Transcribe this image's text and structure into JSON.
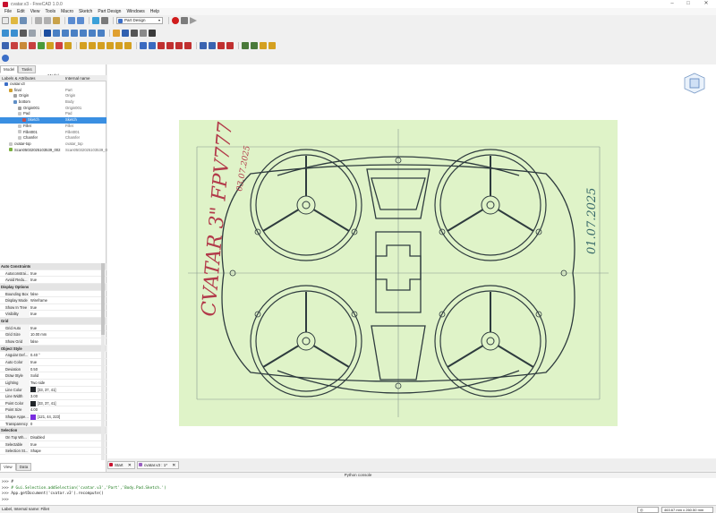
{
  "window": {
    "title": "cvatar.v3 - FreeCAD 1.0.0",
    "controls": [
      "–",
      "□",
      "✕"
    ]
  },
  "menu": [
    "File",
    "Edit",
    "View",
    "Tools",
    "Macro",
    "Sketch",
    "Part Design",
    "Windows",
    "Help"
  ],
  "toolbar": {
    "workbench": "Part Design"
  },
  "left_panel": {
    "tabs": [
      "Model",
      "Tasks"
    ],
    "header_title": "Model",
    "columns": [
      "Labels & Attributes",
      "Internal name"
    ],
    "tree": [
      {
        "label": "cvatar.v3",
        "internal": "",
        "indent": 1,
        "icon": "document-icon",
        "color": "#3b6ec7"
      },
      {
        "label": "final",
        "internal": "Part",
        "indent": 2,
        "icon": "part-icon",
        "color": "#d0a030"
      },
      {
        "label": "Origin",
        "internal": "Origin",
        "indent": 3,
        "icon": "origin-icon",
        "color": "#a0a0a0"
      },
      {
        "label": "bottom",
        "internal": "Body",
        "indent": 3,
        "icon": "body-icon",
        "color": "#5f8fc7"
      },
      {
        "label": "Origin001",
        "internal": "Origin001",
        "indent": 4,
        "icon": "origin-icon",
        "color": "#a0a0a0"
      },
      {
        "label": "Pad",
        "internal": "Pad",
        "indent": 4,
        "icon": "pad-icon",
        "color": "#c7c7c7"
      },
      {
        "label": "Sketch",
        "internal": "Sketch",
        "indent": 5,
        "icon": "sketch-icon",
        "color": "#c45050",
        "selected": true
      },
      {
        "label": "Fillet",
        "internal": "Fillet",
        "indent": 4,
        "icon": "fillet-icon",
        "color": "#c7c7c7"
      },
      {
        "label": "Fillet001",
        "internal": "Fillet001",
        "indent": 4,
        "icon": "fillet-icon",
        "color": "#c7c7c7"
      },
      {
        "label": "Chamfer",
        "internal": "Chamfer",
        "indent": 4,
        "icon": "chamfer-icon",
        "color": "#c7c7c7"
      },
      {
        "label": "cvatar-top",
        "internal": "cvatar_top",
        "indent": 2,
        "icon": "body-icon",
        "color": "#c7c7c7"
      },
      {
        "label": "Scan05032025103539_002",
        "internal": "Scan05032025103539_002",
        "indent": 2,
        "icon": "image-icon",
        "color": "#7ab040"
      }
    ],
    "properties": [
      {
        "group": "Auto Constraints"
      },
      {
        "name": "Autoconstrai...",
        "value": "true"
      },
      {
        "name": "Avoid Redu...",
        "value": "true"
      },
      {
        "group": "Display Options"
      },
      {
        "name": "Bounding Box",
        "value": "false"
      },
      {
        "name": "Display Mode",
        "value": "Wireframe"
      },
      {
        "name": "Show In Tree",
        "value": "true"
      },
      {
        "name": "Visibility",
        "value": "true"
      },
      {
        "group": "Grid"
      },
      {
        "name": "Grid Auto",
        "value": "true"
      },
      {
        "name": "Grid Size",
        "value": "10.00 mm"
      },
      {
        "name": "Show Grid",
        "value": "false"
      },
      {
        "group": "Object Style"
      },
      {
        "name": "Angular Def...",
        "value": "0.40 °"
      },
      {
        "name": "Auto Color",
        "value": "true"
      },
      {
        "name": "Deviation",
        "value": "0.50"
      },
      {
        "name": "Draw Style",
        "value": "Solid"
      },
      {
        "name": "Lighting",
        "value": "Two side"
      },
      {
        "name": "Line Color",
        "value": "[33, 37, 41]",
        "swatch": "#212529"
      },
      {
        "name": "Line Width",
        "value": "3.00"
      },
      {
        "name": "Point Color",
        "value": "[33, 37, 41]",
        "swatch": "#212529"
      },
      {
        "name": "Point Size",
        "value": "4.00"
      },
      {
        "name": "Shape Appe...",
        "value": "[121, 44, 223]",
        "swatch": "#792cdf"
      },
      {
        "name": "Transparency",
        "value": "0"
      },
      {
        "group": "Selection"
      },
      {
        "name": "On Top Wh...",
        "value": "Disabled"
      },
      {
        "name": "Selectable",
        "value": "true"
      },
      {
        "name": "Selection St...",
        "value": "Shape"
      }
    ],
    "bottom_tabs": [
      "View",
      "Data"
    ]
  },
  "doc_tabs": [
    "Start",
    "cvatar.v3 : 1*"
  ],
  "sketch": {
    "handwriting_left": "CVATAR 3\" FPV777",
    "date_top": "03.07.2025",
    "date_right": "01.07.2025"
  },
  "console": {
    "title": "Python console",
    "lines": [
      {
        "prompt": ">>> ",
        "text": "#",
        "style": "code2"
      },
      {
        "prompt": ">>> ",
        "text": "# Gui.Selection.addSelection('cvatar.v3','Part','Body.Pad.Sketch.')",
        "style": "code"
      },
      {
        "prompt": ">>> ",
        "text": "App.getDocument('cvatar.v3').recompute()",
        "style": "code2"
      },
      {
        "prompt": ">>> ",
        "text": "",
        "style": "code2"
      }
    ]
  },
  "status": {
    "text": "Label, Internal name: Fillet",
    "nav": "◎",
    "dims": "463.67 mm x 260.50 mm"
  }
}
